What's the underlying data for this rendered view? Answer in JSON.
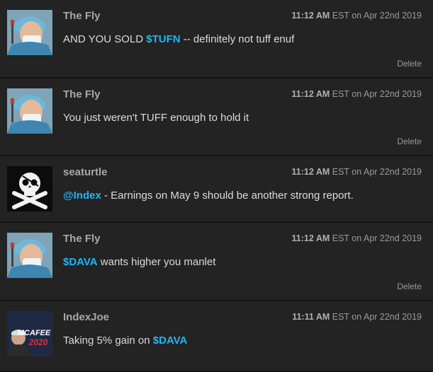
{
  "feed": {
    "posts": [
      {
        "user": "The Fly",
        "avatar_icon": "doctor-avatar-icon",
        "time": "11:12 AM",
        "tz_date": " EST on Apr 22nd 2019",
        "pre": "AND YOU SOLD ",
        "tag": "$TUFN",
        "post": " -- definitely not tuff enuf",
        "delete": "Delete"
      },
      {
        "user": "The Fly",
        "avatar_icon": "doctor-avatar-icon",
        "time": "11:12 AM",
        "tz_date": " EST on Apr 22nd 2019",
        "pre": "You just weren't TUFF enough to hold it",
        "tag": "",
        "post": "",
        "delete": "Delete"
      },
      {
        "user": "seaturtle",
        "avatar_icon": "skull-crossbones-avatar-icon",
        "time": "11:12 AM",
        "tz_date": " EST on Apr 22nd 2019",
        "pre": "",
        "tag": "@Index",
        "post": " - Earnings on May 9 should be another strong report.",
        "delete": ""
      },
      {
        "user": "The Fly",
        "avatar_icon": "doctor-avatar-icon",
        "time": "11:12 AM",
        "tz_date": " EST on Apr 22nd 2019",
        "pre": "",
        "tag": "$DAVA",
        "post": " wants higher you manlet",
        "delete": "Delete"
      },
      {
        "user": "IndexJoe",
        "avatar_icon": "mcafee-2020-avatar-icon",
        "avatar_text_top": "MCAFEE",
        "avatar_text_bottom": "2020",
        "time": "11:11 AM",
        "tz_date": " EST on Apr 22nd 2019",
        "pre": "Taking 5% gain on ",
        "tag": "$DAVA",
        "post": "",
        "delete": ""
      }
    ]
  },
  "colors": {
    "background": "#232323",
    "separator": "#141414",
    "ticker": "#1fb6f5",
    "username": "#a8a8a8"
  }
}
